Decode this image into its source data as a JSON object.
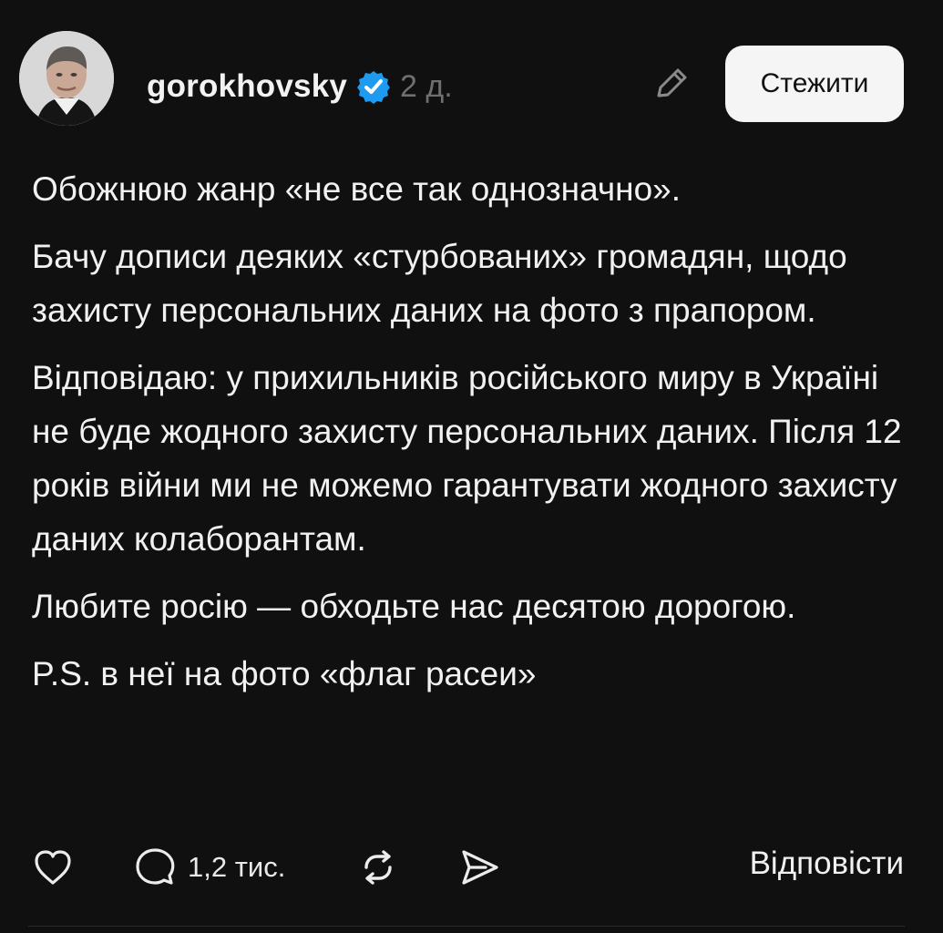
{
  "post": {
    "username": "gorokhovsky",
    "time": "2 д.",
    "follow_label": "Стежити",
    "paragraphs": [
      "Обожнюю жанр «не все так однозначно».",
      "Бачу дописи деяких «стурбованих» громадян, щодо захисту персональних даних на фото з прапором.",
      "Відповідаю: у прихильників російського миру в Україні не буде жодного захисту персональних даних. Після 12 років війни ми не можемо гарантувати жодного захисту даних колаборантам.",
      "Любите росію — обходьте нас десятою дорогою.",
      "P.S. в неї на фото «флаг расеи»"
    ]
  },
  "actions": {
    "comments_count": "1,2 тис.",
    "reply_label": "Відповісти"
  },
  "icons": {
    "verified": "verified-badge-icon",
    "edit": "pencil-icon",
    "like": "heart-icon",
    "comment": "comment-icon",
    "repost": "repost-icon",
    "share": "send-icon"
  },
  "colors": {
    "background": "#101010",
    "text": "#f1f1f1",
    "muted": "#6f6f6f",
    "verified": "#1d9bf0",
    "button": "#f5f5f5"
  }
}
